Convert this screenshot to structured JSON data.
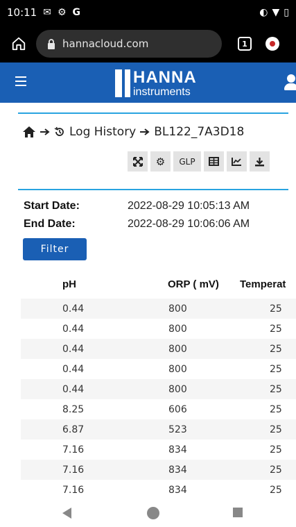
{
  "status_bar": {
    "time": "10:11",
    "left_icons": [
      "mail-icon",
      "gear-icon",
      "g-icon"
    ],
    "right_icons": [
      "sync-icon",
      "wifi-icon",
      "battery-icon"
    ]
  },
  "browser": {
    "url": "hannacloud.com",
    "tab_count": "1"
  },
  "header": {
    "brand": "HANNA",
    "brand_sub": "instruments"
  },
  "breadcrumb": {
    "current_section": "Log History",
    "device": "BL122_7A3D18"
  },
  "toolbar": {
    "glp_label": "GLP",
    "icons": [
      "fullscreen-icon",
      "settings-icon",
      "glp-button",
      "table-icon",
      "chart-icon",
      "download-icon"
    ]
  },
  "dates": {
    "start_label": "Start Date:",
    "start_value": "2022-08-29 10:05:13 AM",
    "end_label": "End Date:",
    "end_value": "2022-08-29 10:06:06 AM"
  },
  "filter": {
    "label": "Filter"
  },
  "table": {
    "columns": [
      "pH",
      "ORP ( mV)",
      "Temperat"
    ],
    "rows": [
      [
        "0.44",
        "800",
        "25"
      ],
      [
        "0.44",
        "800",
        "25"
      ],
      [
        "0.44",
        "800",
        "25"
      ],
      [
        "0.44",
        "800",
        "25"
      ],
      [
        "0.44",
        "800",
        "25"
      ],
      [
        "8.25",
        "606",
        "25"
      ],
      [
        "6.87",
        "523",
        "25"
      ],
      [
        "7.16",
        "834",
        "25"
      ],
      [
        "7.16",
        "834",
        "25"
      ],
      [
        "7.16",
        "834",
        "25"
      ]
    ]
  },
  "colors": {
    "brand_blue": "#1a5fb4",
    "divider_blue": "#29a3e0"
  }
}
